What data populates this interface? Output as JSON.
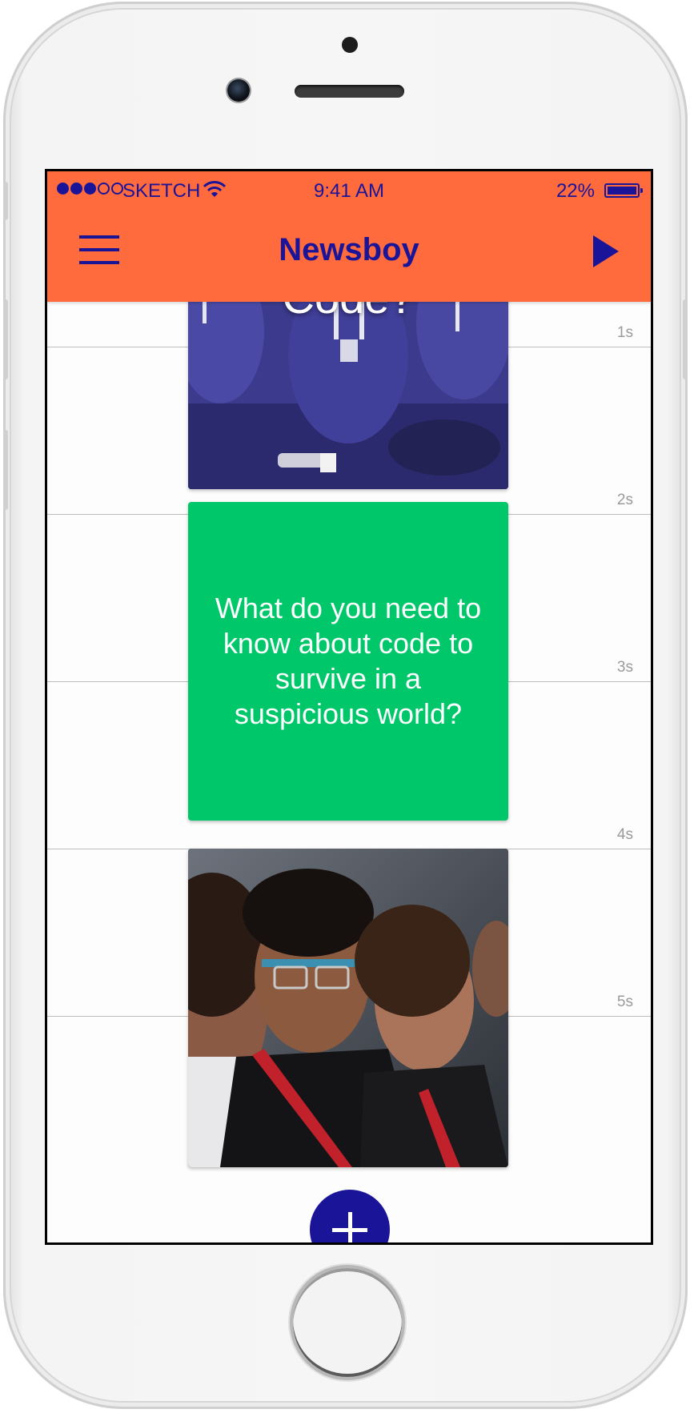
{
  "status_bar": {
    "carrier": "SKETCH",
    "time": "9:41 AM",
    "battery_percent": "22%",
    "signal_bars_filled": 3,
    "signal_bars_total": 5
  },
  "header": {
    "title": "Newsboy",
    "menu_icon": "hamburger-menu-icon",
    "play_icon": "play-icon"
  },
  "timeline": {
    "marks": [
      "1s",
      "2s",
      "3s",
      "4s",
      "5s"
    ]
  },
  "cards": [
    {
      "type": "image",
      "overlay_text": "What is Code?",
      "description_icon": "photo-audience-lanyards"
    },
    {
      "type": "text",
      "text": "What do you need to know about code to survive in a suspicious world?"
    },
    {
      "type": "image",
      "description_icon": "photo-audience-google-glass"
    }
  ],
  "fab": {
    "icon": "plus-icon"
  },
  "colors": {
    "accent": "#ff6b3d",
    "primary": "#1a1499",
    "text_card": "#00c86a"
  }
}
